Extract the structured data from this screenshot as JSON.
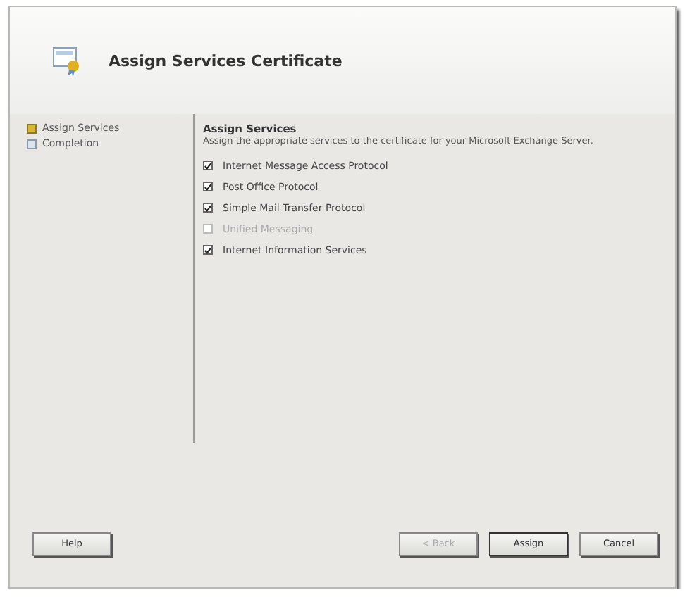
{
  "window": {
    "title": "Assign Services Certificate"
  },
  "steps": [
    {
      "label": "Assign Services",
      "selected": true
    },
    {
      "label": "Completion",
      "selected": false
    }
  ],
  "section": {
    "title": "Assign Services",
    "description": "Assign the appropriate services to the certificate for your Microsoft Exchange Server."
  },
  "services": [
    {
      "label": "Internet Message Access Protocol",
      "checked": true,
      "disabled": false
    },
    {
      "label": "Post Office Protocol",
      "checked": true,
      "disabled": false
    },
    {
      "label": "Simple Mail Transfer Protocol",
      "checked": true,
      "disabled": false
    },
    {
      "label": "Unified Messaging",
      "checked": false,
      "disabled": true
    },
    {
      "label": "Internet Information Services",
      "checked": true,
      "disabled": false
    }
  ],
  "buttons": [
    {
      "label": "Help",
      "disabled": false,
      "default": false
    },
    {
      "label": "< Back",
      "disabled": true,
      "default": false
    },
    {
      "label": "Assign",
      "disabled": false,
      "default": true
    },
    {
      "label": "Cancel",
      "disabled": false,
      "default": false
    }
  ]
}
